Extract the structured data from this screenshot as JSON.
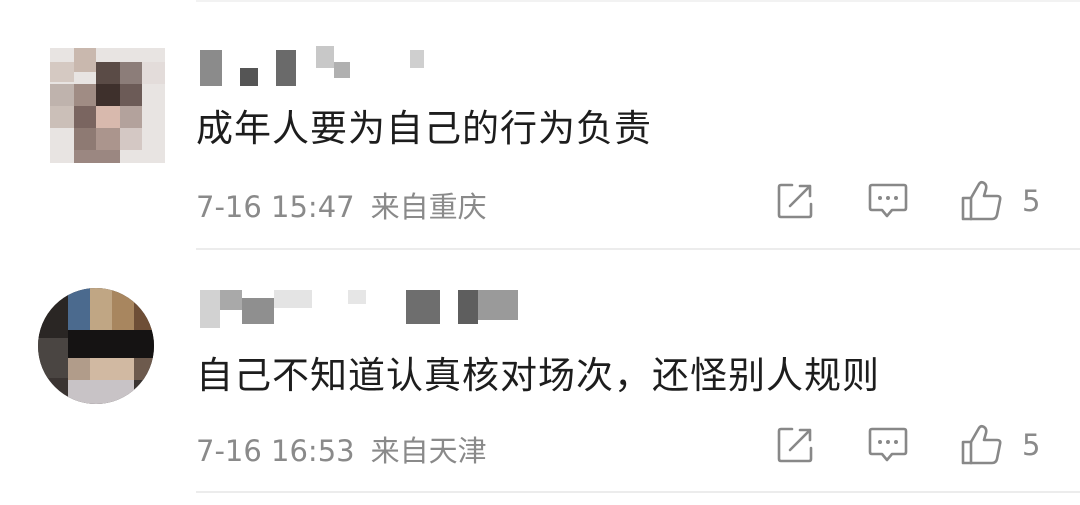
{
  "comments": [
    {
      "text": "成年人要为自己的行为负责",
      "time": "7-16 15:47",
      "location": "来自重庆",
      "like_count": "5",
      "icons": [
        "share-icon",
        "comment-icon",
        "like-icon"
      ]
    },
    {
      "text": "自己不知道认真核对场次，还怪别人规则",
      "time": "7-16 16:53",
      "location": "来自天津",
      "like_count": "5",
      "icons": [
        "share-icon",
        "comment-icon",
        "like-icon"
      ]
    }
  ],
  "colors": {
    "text": "#1d1d1d",
    "meta": "#8a8a8a",
    "icon": "#888888",
    "divider": "#ececec"
  }
}
